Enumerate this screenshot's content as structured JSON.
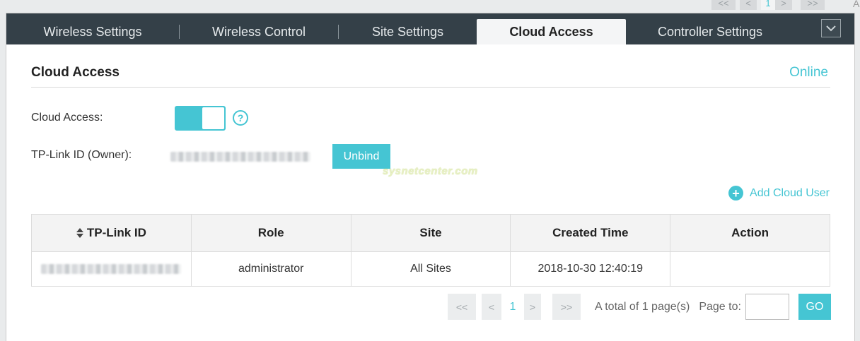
{
  "top_pager": {
    "first": "<<",
    "prev": "<",
    "page": "1",
    "next": ">",
    "last": ">>",
    "partial_letter": "A"
  },
  "tabs": [
    {
      "label": "Wireless Settings"
    },
    {
      "label": "Wireless Control"
    },
    {
      "label": "Site Settings"
    },
    {
      "label": "Cloud Access"
    },
    {
      "label": "Controller Settings"
    }
  ],
  "active_tab": "Cloud Access",
  "menu_icon": "chevron-down-icon",
  "section": {
    "title": "Cloud Access",
    "status": "Online"
  },
  "form": {
    "cloud_access_label": "Cloud Access:",
    "cloud_access_enabled": true,
    "owner_label": "TP-Link ID (Owner):",
    "unbind_label": "Unbind"
  },
  "watermark": "sysnetcenter.com",
  "add_cloud_user_label": "Add Cloud User",
  "table": {
    "columns": [
      "TP-Link ID",
      "Role",
      "Site",
      "Created Time",
      "Action"
    ],
    "rows": [
      {
        "role": "administrator",
        "site": "All Sites",
        "created": "2018-10-30 12:40:19",
        "action": ""
      }
    ]
  },
  "pager": {
    "first": "<<",
    "prev": "<",
    "page": "1",
    "next": ">",
    "last": ">>",
    "total_text": "A total of 1 page(s)",
    "page_to_label": "Page to:",
    "page_to_value": "",
    "go_label": "GO"
  },
  "colors": {
    "accent": "#45c5d3",
    "tabbar": "#344048"
  }
}
